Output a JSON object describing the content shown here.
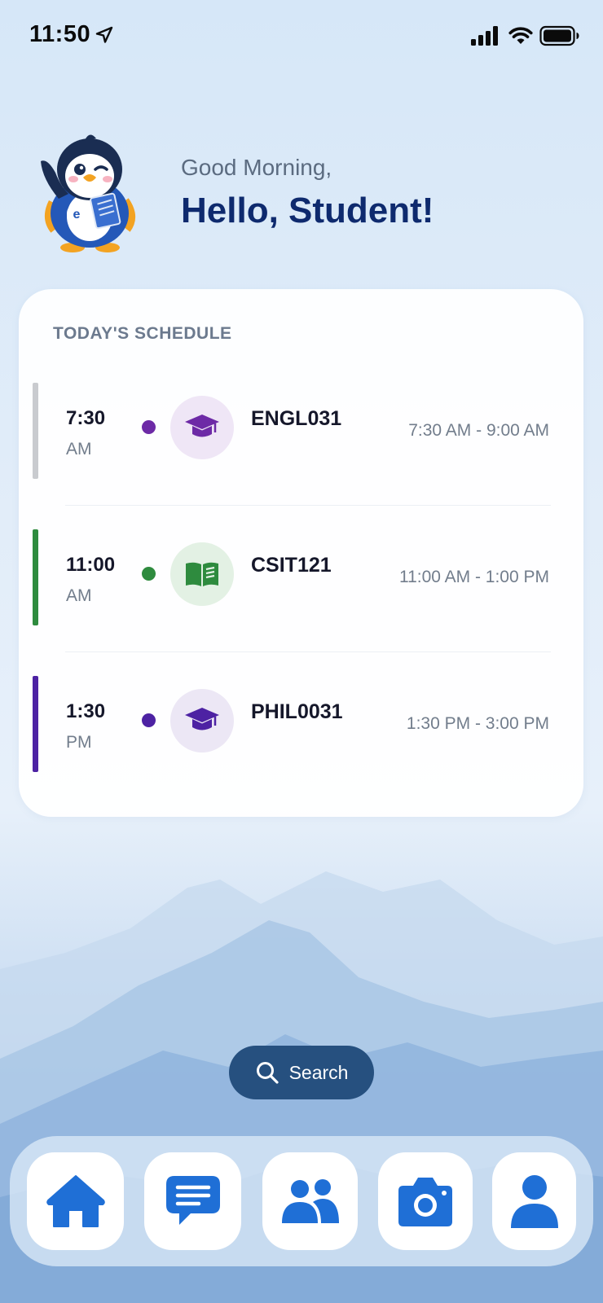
{
  "status_bar": {
    "time": "11:50",
    "icons": [
      "location-arrow-icon",
      "cellular-signal-icon",
      "wifi-icon",
      "battery-icon"
    ]
  },
  "greeting": {
    "subtitle": "Good Morning,",
    "title": "Hello, Student!",
    "mascot": "penguin-mascot-icon"
  },
  "schedule": {
    "title": "TODAY'S SCHEDULE",
    "items": [
      {
        "time": "7:30",
        "period": "AM",
        "course": "ENGL031",
        "range": "7:30 AM - 9:00 AM",
        "icon": "graduation-cap-icon",
        "bar_color": "#c9cbcf",
        "dot_color": "#6d2aa6",
        "icon_bg": "#efe6f6",
        "icon_color": "#6d2aa6"
      },
      {
        "time": "11:00",
        "period": "AM",
        "course": "CSIT121",
        "range": "11:00 AM - 1:00 PM",
        "icon": "open-book-icon",
        "bar_color": "#2e8b3e",
        "dot_color": "#2e8b3e",
        "icon_bg": "#e3f1e4",
        "icon_color": "#2e8b3e"
      },
      {
        "time": "1:30",
        "period": "PM",
        "course": "PHIL0031",
        "range": "1:30 PM - 3:00 PM",
        "icon": "graduation-cap-icon",
        "bar_color": "#4d22a3",
        "dot_color": "#4d22a3",
        "icon_bg": "#ece7f5",
        "icon_color": "#4d22a3"
      }
    ]
  },
  "search": {
    "label": "Search",
    "icon": "search-icon"
  },
  "tabbar": {
    "items": [
      "home-icon",
      "chat-icon",
      "people-icon",
      "camera-icon",
      "profile-icon"
    ],
    "icon_color": "#1f6fd6"
  },
  "colors": {
    "title": "#0e2a6e",
    "search_bg": "#26507f",
    "accent": "#1f6fd6"
  }
}
